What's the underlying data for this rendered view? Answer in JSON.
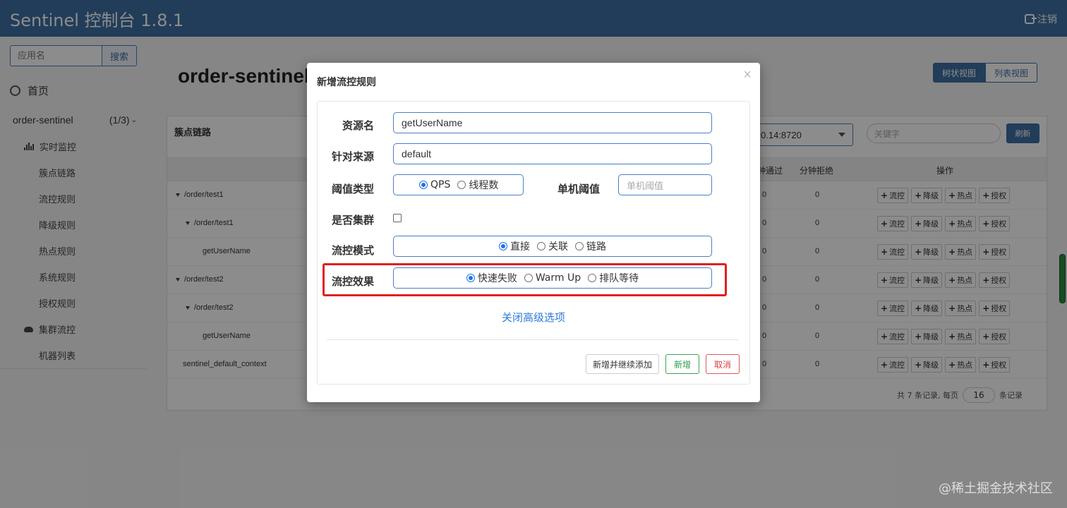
{
  "header": {
    "brand": "Sentinel 控制台 1.8.1",
    "logout": "注销"
  },
  "sidebar": {
    "search_placeholder": "应用名",
    "search_button": "搜索",
    "home": "首页",
    "app_name": "order-sentinel",
    "app_count": "(1/3)",
    "items": [
      {
        "label": "实时监控",
        "icon": "bar-chart-icon"
      },
      {
        "label": "簇点链路"
      },
      {
        "label": "流控规则"
      },
      {
        "label": "降级规则"
      },
      {
        "label": "热点规则"
      },
      {
        "label": "系统规则"
      },
      {
        "label": "授权规则"
      },
      {
        "label": "集群流控",
        "icon": "cloud-icon"
      },
      {
        "label": "机器列表"
      }
    ]
  },
  "main": {
    "title": "order-sentinel",
    "view_tree": "树状视图",
    "view_list": "列表视图",
    "panel_title": "簇点链路",
    "machine_value": "0.14:8720",
    "keyword_placeholder": "关键字",
    "refresh": "刷新",
    "columns": {
      "pass": "钟通过",
      "reject": "分钟拒绝",
      "ops": "操作"
    },
    "rows": [
      {
        "resource": "/order/test1",
        "level": 0,
        "expand": true,
        "pass": "0",
        "reject": "0"
      },
      {
        "resource": "/order/test1",
        "level": 1,
        "expand": true,
        "pass": "0",
        "reject": "0"
      },
      {
        "resource": "getUserName",
        "level": 2,
        "expand": false,
        "pass": "0",
        "reject": "0"
      },
      {
        "resource": "/order/test2",
        "level": 0,
        "expand": true,
        "pass": "0",
        "reject": "0"
      },
      {
        "resource": "/order/test2",
        "level": 1,
        "expand": true,
        "pass": "0",
        "reject": "0"
      },
      {
        "resource": "getUserName",
        "level": 2,
        "expand": false,
        "pass": "0",
        "reject": "0"
      },
      {
        "resource": "sentinel_default_context",
        "level": -1,
        "expand": false,
        "pass": "0",
        "reject": "0"
      }
    ],
    "ops": [
      "流控",
      "降级",
      "热点",
      "授权"
    ],
    "pager": {
      "prefix": "共 7 条记录, 每页",
      "page_size": "16",
      "suffix": "条记录"
    }
  },
  "modal": {
    "title": "新增流控规则",
    "close": "×",
    "resource_label": "资源名",
    "resource_value": "getUserName",
    "origin_label": "针对来源",
    "origin_value": "default",
    "grade_label": "阈值类型",
    "grade_options": [
      "QPS",
      "线程数"
    ],
    "grade_selected": 0,
    "threshold_label": "单机阈值",
    "threshold_placeholder": "单机阈值",
    "cluster_label": "是否集群",
    "strategy_label": "流控模式",
    "strategy_options": [
      "直接",
      "关联",
      "链路"
    ],
    "strategy_selected": 0,
    "effect_label": "流控效果",
    "effect_options": [
      "快速失败",
      "Warm Up",
      "排队等待"
    ],
    "effect_selected": 0,
    "advanced_link": "关闭高级选项",
    "btn_add_continue": "新增并继续添加",
    "btn_add": "新增",
    "btn_cancel": "取消"
  },
  "watermark": "@稀土掘金技术社区",
  "colors": {
    "header_bg": "#3c6fa3",
    "accent": "#1a73e8",
    "highlight": "#e02020",
    "success": "#2f9d4e",
    "danger": "#d94040"
  }
}
